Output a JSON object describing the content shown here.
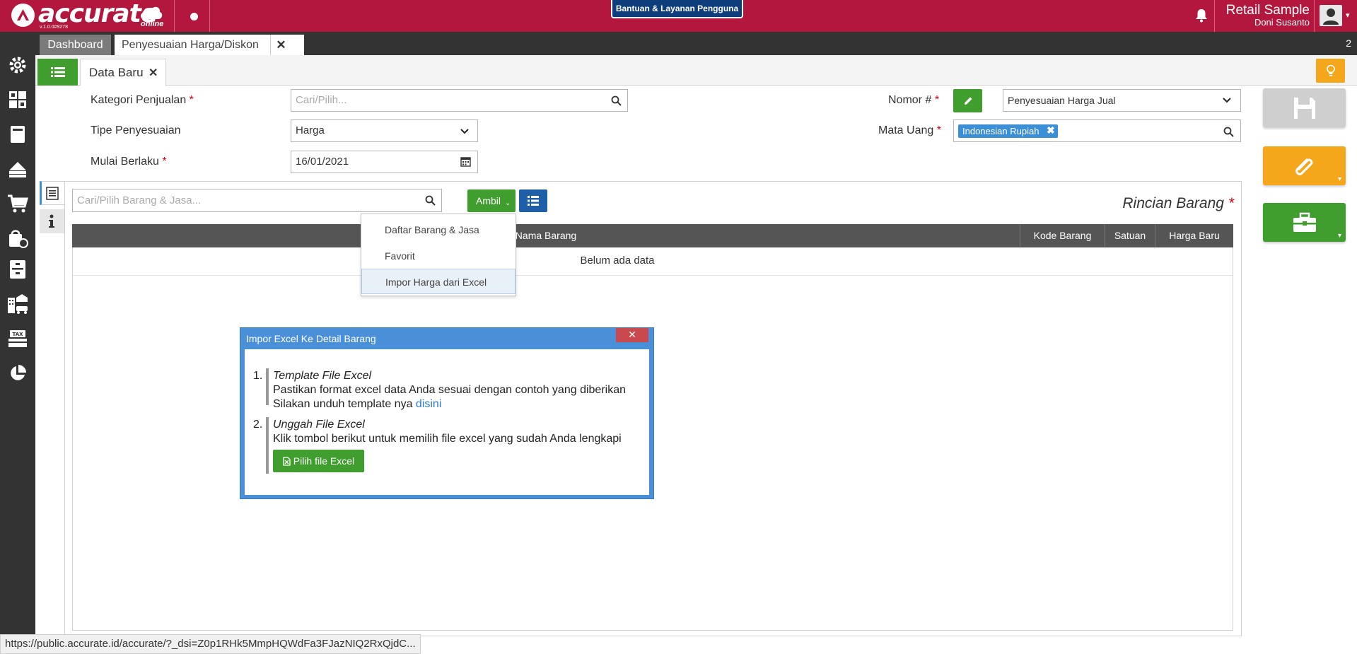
{
  "app": {
    "logo_text": "accurate",
    "logo_sub": "online",
    "version": "v.1.0.0#9278",
    "help_label": "Bantuan & Layanan Pengguna",
    "company": "Retail Sample",
    "user": "Doni Susanto"
  },
  "tabs": {
    "dashboard": "Dashboard",
    "active": "Penyesuaian Harga/Diskon",
    "close_glyph": "✕",
    "count": "2"
  },
  "inner_tab": {
    "label": "Data Baru",
    "close_glyph": "✕"
  },
  "form": {
    "kategori_label": "Kategori Penjualan",
    "kategori_placeholder": "Cari/Pilih...",
    "tipe_label": "Tipe Penyesuaian",
    "tipe_value": "Harga",
    "mulai_label": "Mulai Berlaku",
    "mulai_value": "16/01/2021",
    "nomor_label": "Nomor #",
    "nomor_value": "Penyesuaian Harga Jual",
    "mata_uang_label": "Mata Uang",
    "mata_uang_tag": "Indonesian Rupiah",
    "required_mark": "*"
  },
  "detail": {
    "search_placeholder": "Cari/Pilih Barang & Jasa...",
    "ambil_label": "Ambil",
    "title": "Rincian Barang",
    "columns": [
      "Nama Barang",
      "Kode Barang",
      "Satuan",
      "Harga Baru"
    ],
    "empty_text": "Belum ada data"
  },
  "dropdown": {
    "items": [
      "Daftar Barang & Jasa",
      "Favorit",
      "Impor Harga dari Excel"
    ]
  },
  "modal": {
    "title": "Impor Excel Ke Detail Barang",
    "close_glyph": "✕",
    "step1_num": "1.",
    "step1_title": "Template File Excel",
    "step1_line1": "Pastikan format excel data Anda sesuai dengan contoh yang diberikan",
    "step1_line2": "Silakan unduh template nya ",
    "step1_link": "disini",
    "step2_num": "2.",
    "step2_title": "Unggah File Excel",
    "step2_line1": "Klik tombol berikut untuk memilih file excel yang sudah Anda lengkapi",
    "button_label": "Pilih file Excel"
  },
  "status_url": "https://public.accurate.id/accurate/?_dsi=Z0p1RHk5MmpHQWdFa3FJazNIQ2RxQjdC...",
  "colors": {
    "brand": "#b3173d",
    "green": "#3f9e2e",
    "orange": "#f5a71b",
    "blue": "#1f5fa8",
    "modal_blue": "#4a90d9"
  }
}
